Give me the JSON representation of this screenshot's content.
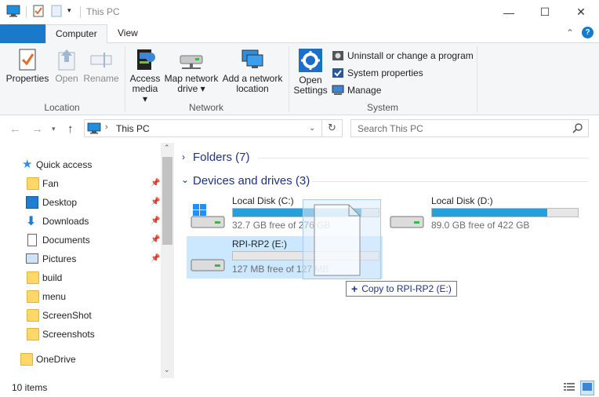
{
  "window": {
    "title": "This PC",
    "min_glyph": "—",
    "max_glyph": "☐",
    "close_glyph": "✕"
  },
  "ribbon": {
    "tabs": {
      "computer": "Computer",
      "view": "View"
    },
    "help_glyph": "?",
    "collapse_glyph": "⌃",
    "location": {
      "label": "Location",
      "properties": "Properties",
      "open": "Open",
      "rename": "Rename"
    },
    "network": {
      "label": "Network",
      "access_media_1": "Access",
      "access_media_2": "media ▾",
      "map_drive_1": "Map network",
      "map_drive_2": "drive ▾",
      "add_location_1": "Add a network",
      "add_location_2": "location"
    },
    "system": {
      "label": "System",
      "open_settings_1": "Open",
      "open_settings_2": "Settings",
      "uninstall": "Uninstall or change a program",
      "system_properties": "System properties",
      "manage": "Manage"
    }
  },
  "address": {
    "path": "This PC",
    "search_placeholder": "Search This PC"
  },
  "nav": {
    "quick_access": "Quick access",
    "items": [
      {
        "label": "Fan",
        "pinned": true
      },
      {
        "label": "Desktop",
        "pinned": true
      },
      {
        "label": "Downloads",
        "pinned": true
      },
      {
        "label": "Documents",
        "pinned": true
      },
      {
        "label": "Pictures",
        "pinned": true
      },
      {
        "label": "build",
        "pinned": false
      },
      {
        "label": "menu",
        "pinned": false
      },
      {
        "label": "ScreenShot",
        "pinned": false
      },
      {
        "label": "Screenshots",
        "pinned": false
      }
    ],
    "onedrive": "OneDrive"
  },
  "content": {
    "folders_header": "Folders (7)",
    "devices_header": "Devices and drives (3)",
    "drives": [
      {
        "name": "Local Disk (C:)",
        "free": "32.7 GB free of 276 GB",
        "used_fraction": 0.88
      },
      {
        "name": "Local Disk (D:)",
        "free": "89.0 GB free of 422 GB",
        "used_fraction": 0.79
      },
      {
        "name": "RPI-RP2 (E:)",
        "free": "127 MB free of 127 MB",
        "used_fraction": 0.0
      }
    ],
    "drag_tooltip": "Copy to RPI-RP2 (E:)"
  },
  "status": {
    "items_count": "10 items"
  },
  "colors": {
    "accent": "#26a0da",
    "selection": "#cce8ff",
    "section_head": "#1e3287"
  }
}
